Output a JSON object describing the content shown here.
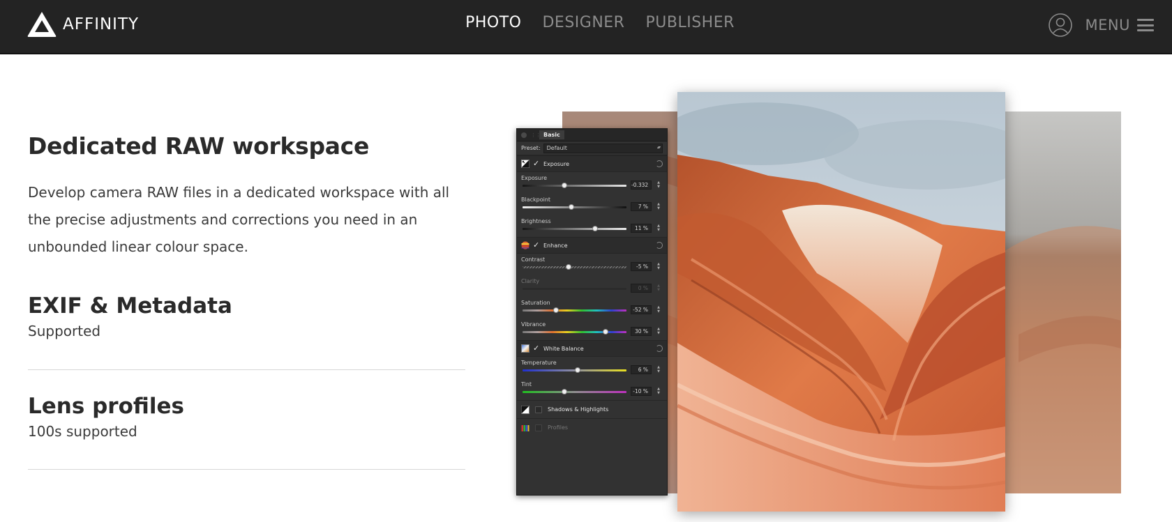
{
  "header": {
    "brand": "AFFINITY",
    "nav": [
      {
        "label": "PHOTO",
        "active": true
      },
      {
        "label": "DESIGNER",
        "active": false
      },
      {
        "label": "PUBLISHER",
        "active": false
      }
    ],
    "menu_label": "MENU"
  },
  "main": {
    "title": "Dedicated RAW workspace",
    "description": "Develop camera RAW files in a dedicated workspace with all the precise adjustments and corrections you need in an unbounded linear colour space.",
    "features": [
      {
        "title": "EXIF & Metadata",
        "subtitle": "Supported"
      },
      {
        "title": "Lens profiles",
        "subtitle": "100s supported"
      }
    ]
  },
  "panel": {
    "tab": "Basic",
    "preset_label": "Preset:",
    "preset_value": "Default",
    "sections": {
      "exposure": {
        "title": "Exposure",
        "rows": [
          {
            "label": "Exposure",
            "value": "-0.332",
            "level": 0.4
          },
          {
            "label": "Blackpoint",
            "value": "7 %",
            "level": 0.47
          },
          {
            "label": "Brightness",
            "value": "11 %",
            "level": 0.7
          }
        ]
      },
      "enhance": {
        "title": "Enhance",
        "rows": [
          {
            "label": "Contrast",
            "value": "-5 %",
            "level": 0.44
          },
          {
            "label": "Clarity",
            "value": "0 %",
            "level": 0.5
          },
          {
            "label": "Saturation",
            "value": "-52 %",
            "level": 0.32
          },
          {
            "label": "Vibrance",
            "value": "30 %",
            "level": 0.8
          }
        ]
      },
      "white_balance": {
        "title": "White Balance",
        "rows": [
          {
            "label": "Temperature",
            "value": "6 %",
            "level": 0.53
          },
          {
            "label": "Tint",
            "value": "-10 %",
            "level": 0.4
          }
        ]
      }
    },
    "footer_sections": [
      "Shadows & Highlights",
      "Profiles"
    ]
  },
  "colors": {
    "topbar": "#232323",
    "nav_active": "#ffffff",
    "nav_inactive": "#8c8c8c"
  }
}
